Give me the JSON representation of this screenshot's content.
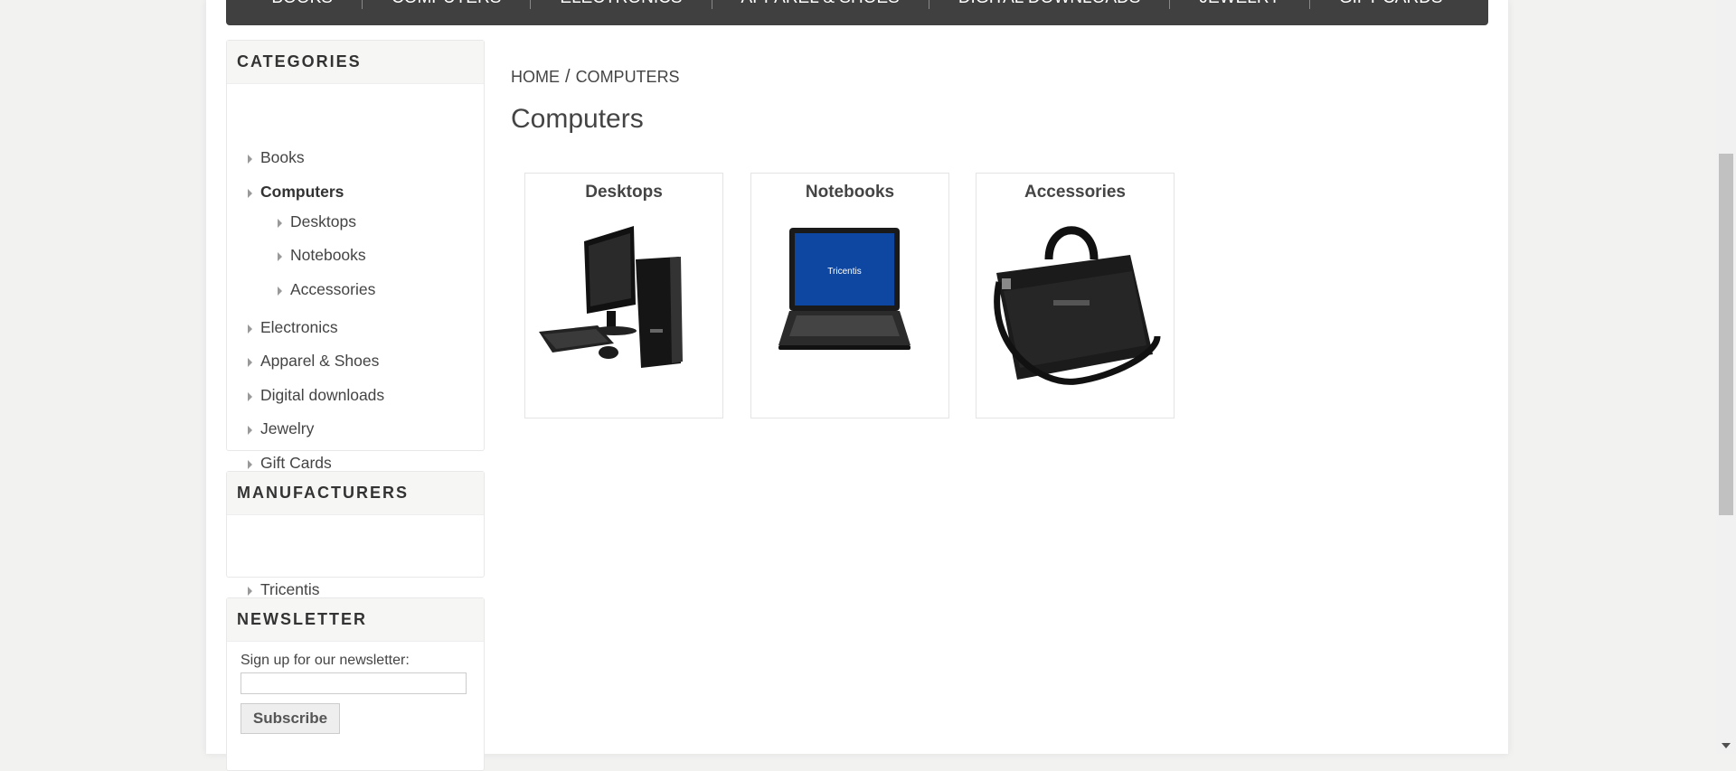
{
  "topmenu": [
    "BOOKS",
    "COMPUTERS",
    "ELECTRONICS",
    "APPAREL & SHOES",
    "DIGITAL DOWNLOADS",
    "JEWELRY",
    "GIFT CARDS"
  ],
  "categories": {
    "title": "CATEGORIES",
    "items": [
      "Books",
      "Computers",
      "Desktops",
      "Notebooks",
      "Accessories",
      "Electronics",
      "Apparel & Shoes",
      "Digital downloads",
      "Jewelry",
      "Gift Cards"
    ],
    "active": "Computers"
  },
  "manufacturers": {
    "title": "MANUFACTURERS",
    "items": [
      "Tricentis"
    ]
  },
  "newsletter": {
    "title": "NEWSLETTER",
    "label": "Sign up for our newsletter:",
    "input_value": "",
    "button": "Subscribe"
  },
  "breadcrumb": {
    "home": "HOME",
    "separator": "/",
    "current": "COMPUTERS"
  },
  "page_title": "Computers",
  "subcategories": [
    {
      "name": "Desktops",
      "image": "desktop-computer-image"
    },
    {
      "name": "Notebooks",
      "image": "notebook-laptop-image"
    },
    {
      "name": "Accessories",
      "image": "laptop-bag-image"
    }
  ],
  "notebook_screen_logo": "Tricentis",
  "colors": {
    "menu_bg": "#404040",
    "notebook_screen": "#0d47a1"
  }
}
